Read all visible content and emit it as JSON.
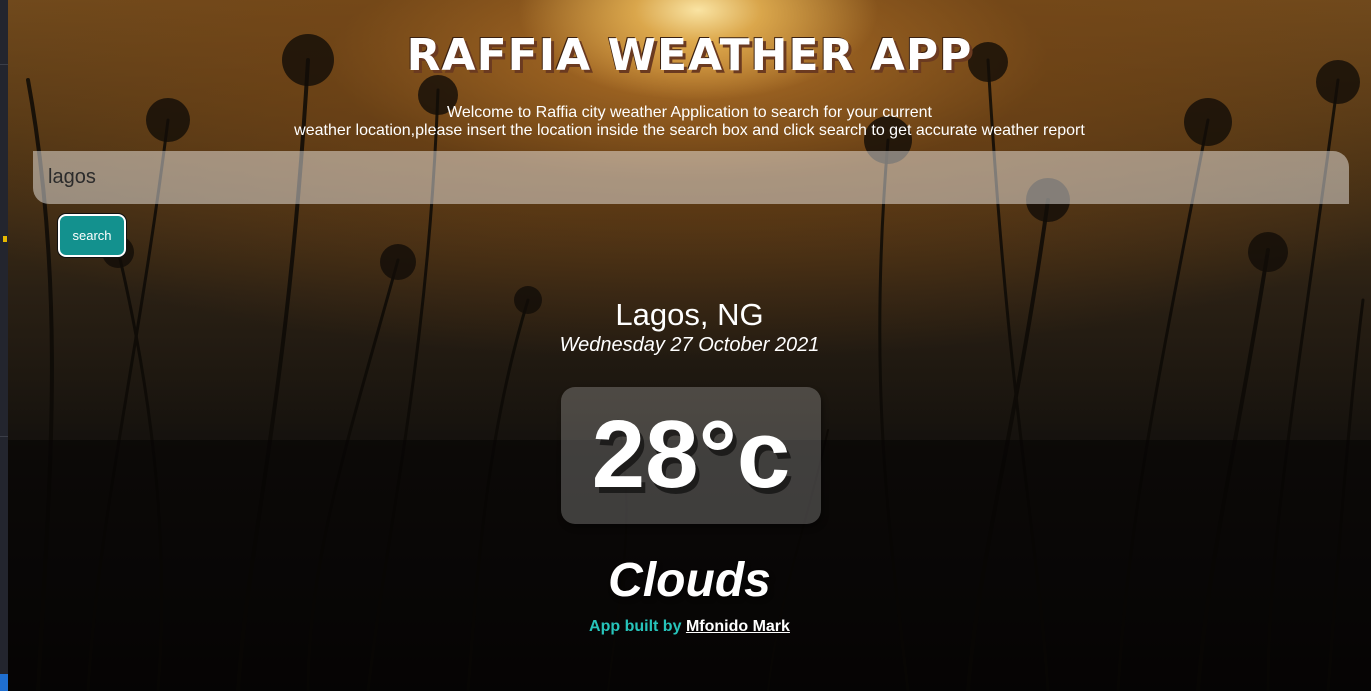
{
  "header": {
    "title": "RAFFIA WEATHER APP",
    "intro_line1": "Welcome to Raffia city weather Application to search for your current",
    "intro_line2": "weather location,please insert the location inside the search box and click search to get accurate weather report"
  },
  "search": {
    "value": "lagos",
    "button_label": "search"
  },
  "weather": {
    "location": "Lagos, NG",
    "date": "Wednesday 27 October 2021",
    "temperature": "28°c",
    "condition": "Clouds"
  },
  "footer": {
    "credit_prefix": "App built by",
    "author": "Mfonido Mark"
  },
  "colors": {
    "accent": "#13918e",
    "credit_text": "#27c4bb"
  }
}
